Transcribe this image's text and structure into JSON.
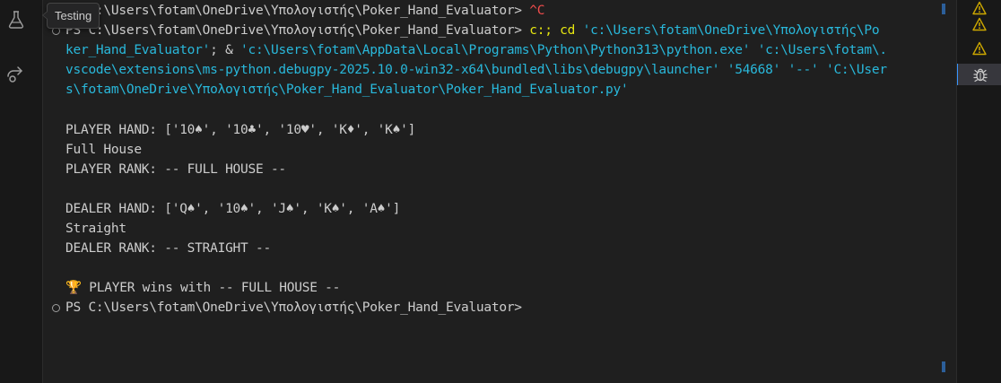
{
  "activity_bar": {
    "items": [
      {
        "name": "testing-flask-icon"
      },
      {
        "name": "remote-share-icon"
      }
    ],
    "tooltip": "Testing"
  },
  "terminal": {
    "colors": {
      "foreground": "#cccccc",
      "yellow": "#e5e510",
      "cyan": "#29b8db",
      "red": "#f14c4c"
    },
    "lines": [
      {
        "prefix": "PS C:\\Users\\fotam\\OneDrive\\Υπολογιστής\\Poker_Hand_Evaluator> ",
        "interrupt": "^C"
      },
      {
        "prompt": "PS C:\\Users\\fotam\\OneDrive\\Υπολογιστής\\Poker_Hand_Evaluator> ",
        "cmd_a": "c:; cd ",
        "arg_a": "'c:\\Users\\fotam\\OneDrive\\Υπολογιστής\\Po"
      },
      {
        "arg_b": "ker_Hand_Evaluator'",
        "sep": "; & ",
        "arg_c": "'c:\\Users\\fotam\\AppData\\Local\\Programs\\Python\\Python313\\python.exe'",
        "gap": " ",
        "arg_d": "'c:\\Users\\fotam\\."
      },
      {
        "text": "vscode\\extensions\\ms-python.debugpy-2025.10.0-win32-x64\\bundled\\libs\\debugpy\\launcher' '54668' '--' 'C:\\User"
      },
      {
        "text": "s\\fotam\\OneDrive\\Υπολογιστής\\Poker_Hand_Evaluator\\Poker_Hand_Evaluator.py'"
      },
      {
        "text": "PLAYER HAND: ['10♠', '10♣', '10♥', 'K♦', 'K♠']"
      },
      {
        "text": "Full House"
      },
      {
        "text": "PLAYER RANK: -- FULL HOUSE --"
      },
      {
        "text": "DEALER HAND: ['Q♠', '10♠', 'J♠', 'K♠', 'A♠']"
      },
      {
        "text": "Straight"
      },
      {
        "text": "DEALER RANK: -- STRAIGHT --"
      },
      {
        "trophy": "🏆",
        "text": " PLAYER wins with -- FULL HOUSE --"
      },
      {
        "text": "PS C:\\Users\\fotam\\OneDrive\\Υπολογιστής\\Poker_Hand_Evaluator>"
      }
    ]
  },
  "right_panel": {
    "items": [
      {
        "name": "warning-icon",
        "color": "#cca700"
      },
      {
        "name": "warning-icon",
        "color": "#cca700"
      },
      {
        "name": "warning-icon",
        "color": "#cca700"
      },
      {
        "name": "debug-bug-icon",
        "active": true
      }
    ]
  }
}
